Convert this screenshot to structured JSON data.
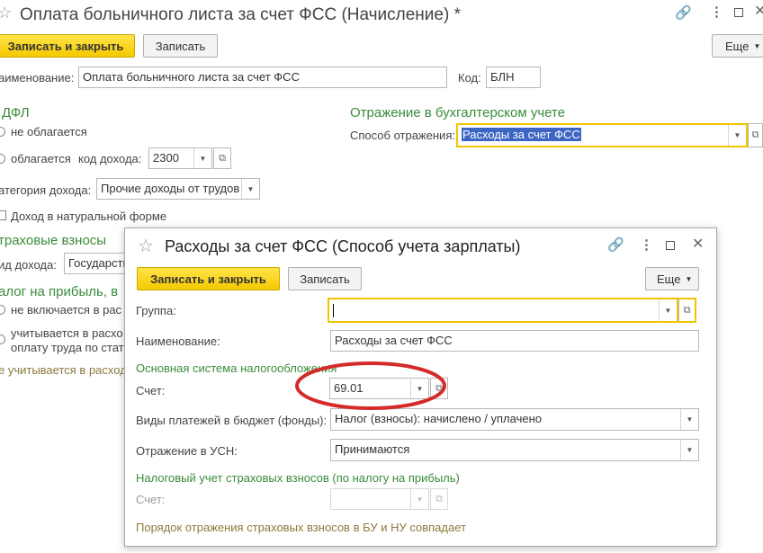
{
  "main": {
    "title": "Оплата больничного листа за счет ФСС (Начисление) *",
    "toolbar": {
      "save_close": "Записать и закрыть",
      "save": "Записать",
      "more": "Еще"
    },
    "name_label": "аименование:",
    "name_value": "Оплата больничного листа за счет ФСС",
    "code_label": "Код:",
    "code_value": "БЛН",
    "ndfl_header": "ДФЛ",
    "ndfl_not_taxed": "не облагается",
    "ndfl_taxed": "облагается",
    "income_code_label": "код дохода:",
    "income_code_value": "2300",
    "income_category_label": "атегория дохода:",
    "income_category_value": "Прочие доходы от трудов",
    "natural_income_label": "Доход в натуральной форме",
    "insurance_header": "траховые взносы",
    "income_type_label": "ид дохода:",
    "income_type_value": "Государств",
    "profit_tax_header": "алог на прибыль, в",
    "profit_not_included": "не включается в рас",
    "profit_included_1": "учитывается в расхо",
    "profit_included_2": "оплату труда по стат",
    "not_accounted_text": "е учитывается в расход",
    "accounting_header": "Отражение в бухгалтерском учете",
    "reflection_method_label": "Способ отражения:",
    "reflection_method_value": "Расходы за счет ФСС"
  },
  "dialog": {
    "title": "Расходы за счет ФСС (Способ учета зарплаты)",
    "toolbar": {
      "save_close": "Записать и закрыть",
      "save": "Записать",
      "more": "Еще"
    },
    "group_label": "Группа:",
    "group_value": "",
    "name_label": "Наименование:",
    "name_value": "Расходы за счет ФСС",
    "osn_header": "Основная система налогообложения",
    "account_label": "Счет:",
    "account_value": "69.01",
    "payment_types_label": "Виды платежей в бюджет (фонды):",
    "payment_types_value": "Налог (взносы): начислено / уплачено",
    "usn_label": "Отражение в УСН:",
    "usn_value": "Принимаются",
    "tax_accounting_header": "Налоговый учет страховых взносов (по налогу на прибыль)",
    "tax_account_label": "Счет:",
    "tax_account_value": "",
    "footer_note": "Порядок отражения страховых взносов в БУ и НУ совпадает"
  },
  "colors": {
    "accent_yellow": "#f5c900",
    "green_header": "#3a8c3a",
    "annotation_red": "#d42a2a",
    "selection_blue": "#3d66c4"
  }
}
